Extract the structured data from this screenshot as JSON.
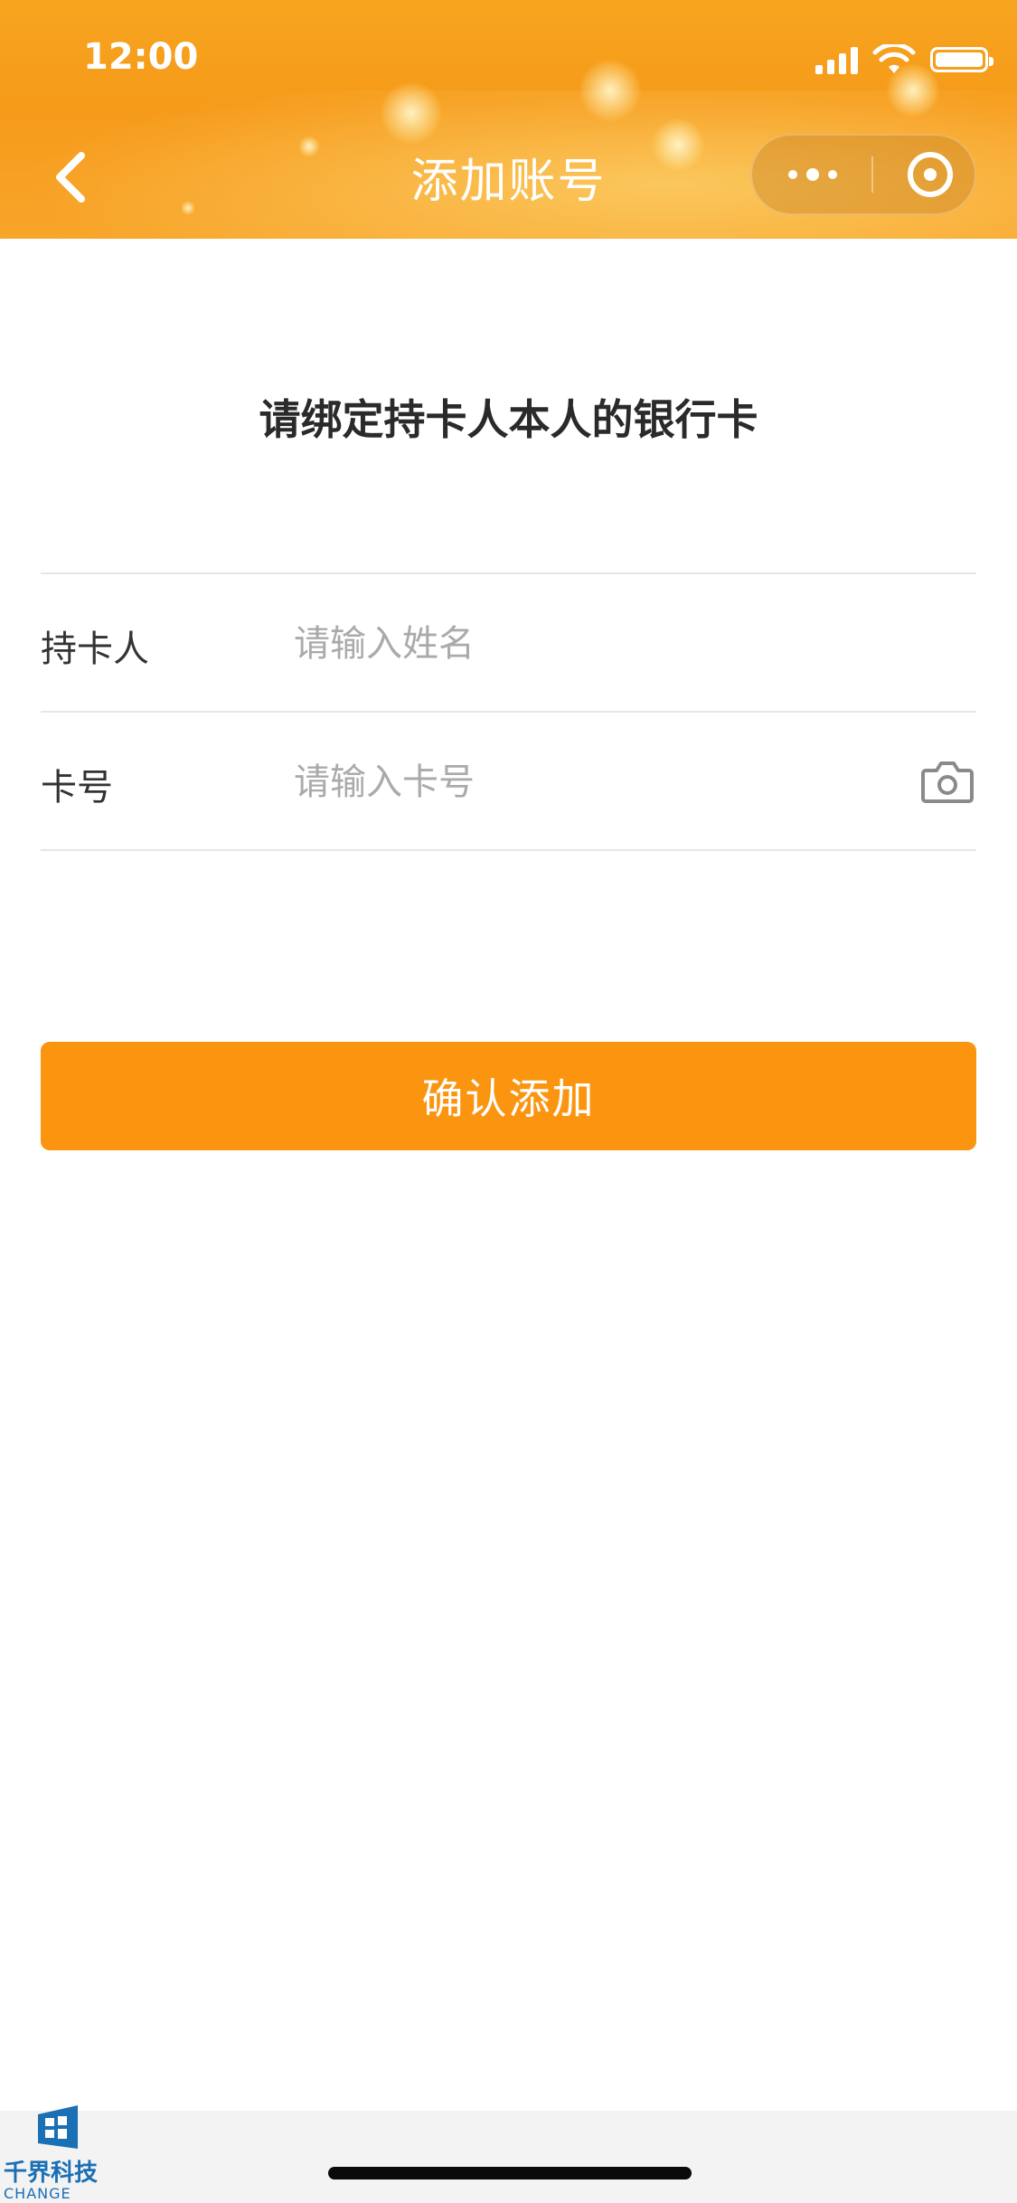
{
  "status_bar": {
    "time": "12:00"
  },
  "nav": {
    "title": "添加账号"
  },
  "prompt": "请绑定持卡人本人的银行卡",
  "form": {
    "holder": {
      "label": "持卡人",
      "placeholder": "请输入姓名",
      "value": ""
    },
    "card": {
      "label": "卡号",
      "placeholder": "请输入卡号",
      "value": ""
    }
  },
  "confirm_button": "确认添加",
  "watermark": {
    "name": "千界科技",
    "sub": "CHANGE"
  },
  "colors": {
    "accent": "#fb9510",
    "header": "#f69a1a",
    "watermark": "#1a6fb5"
  },
  "icons": [
    "back-arrow-icon",
    "more-dots-icon",
    "close-target-icon",
    "camera-icon",
    "signal-icon",
    "wifi-icon",
    "battery-icon"
  ]
}
